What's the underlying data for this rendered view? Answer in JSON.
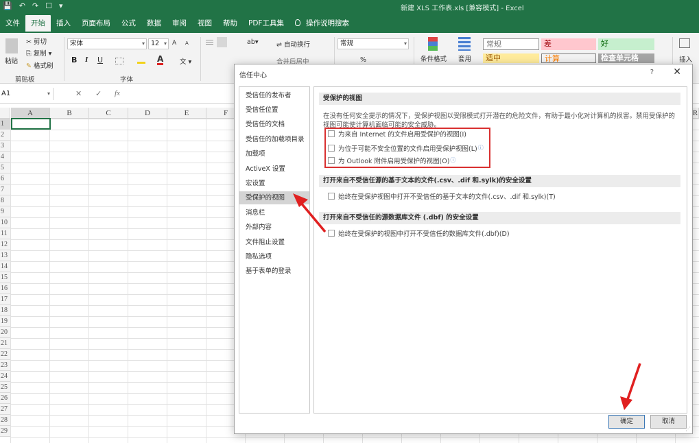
{
  "titlebar": {
    "quick_access": [
      "💾",
      "↶",
      "↷",
      "☐",
      "▾"
    ],
    "title": "新建 XLS 工作表.xls  [兼容模式]  -  Excel"
  },
  "tabs": [
    "文件",
    "开始",
    "插入",
    "页面布局",
    "公式",
    "数据",
    "审阅",
    "视图",
    "帮助",
    "PDF工具集",
    "操作说明搜索"
  ],
  "ribbon": {
    "clipboard": {
      "paste": "粘贴",
      "cut": "剪切",
      "copy": "复制",
      "format_painter": "格式刷",
      "label": "剪贴板"
    },
    "font": {
      "name": "宋体",
      "size": "12",
      "label": "字体",
      "bold": "B",
      "italic": "I",
      "underline": "U",
      "grow": "A",
      "shrink": "A",
      "color": "A"
    },
    "alignment": {
      "wrap": "自动换行",
      "merge": "合并后居中"
    },
    "number": {
      "format": "常规",
      "percent": "%"
    },
    "styles": {
      "conditional": "条件格式",
      "table": "套用",
      "cells": [
        "常规",
        "差",
        "好",
        "适中",
        "计算",
        "检查单元格"
      ]
    },
    "insert": "插入"
  },
  "formula_bar": {
    "name_box": "A1",
    "cancel": "✕",
    "enter": "✓",
    "fx": "fx"
  },
  "grid": {
    "columns": [
      "A",
      "B",
      "C",
      "D",
      "E",
      "F"
    ],
    "rows": [
      "1",
      "2",
      "3",
      "4",
      "5",
      "6",
      "7",
      "8",
      "9",
      "10",
      "11",
      "12",
      "13",
      "14",
      "15",
      "16",
      "17",
      "18",
      "19",
      "20",
      "21",
      "22",
      "23",
      "24",
      "25",
      "26",
      "27",
      "28",
      "29"
    ],
    "right_col": "R"
  },
  "dialog": {
    "title": "信任中心",
    "help": "?",
    "close": "✕",
    "nav": [
      "受信任的发布者",
      "受信任位置",
      "受信任的文档",
      "受信任的加载项目录",
      "加载项",
      "ActiveX 设置",
      "宏设置",
      "受保护的视图",
      "消息栏",
      "外部内容",
      "文件阻止设置",
      "隐私选项",
      "基于表单的登录"
    ],
    "selected_nav": "受保护的视图",
    "section1": {
      "header": "受保护的视图",
      "description": "在没有任何安全提示的情况下，受保护视图以受限模式打开潜在的危险文件，有助于最小化对计算机的损害。禁用受保护的视图可能使计算机面临可能的安全威胁。",
      "options": [
        {
          "label": "为来自 Internet 的文件启用受保护的视图(I)",
          "info": "",
          "checked": false
        },
        {
          "label": "为位于可能不安全位置的文件启用受保护视图(L)",
          "info": "ⓘ",
          "checked": false
        },
        {
          "label": "为 Outlook 附件启用受保护的视图(O)",
          "info": "ⓘ",
          "checked": false
        }
      ]
    },
    "section2": {
      "header": "打开来自不受信任源的基于文本的文件(.csv、.dif 和.sylk)的安全设置",
      "option": "始终在受保护视图中打开不受信任的基于文本的文件(.csv、.dif 和.sylk)(T)"
    },
    "section3": {
      "header": "打开来自不受信任的源数据库文件 (.dbf) 的安全设置",
      "option": "始终在受保护的视图中打开不受信任的数据库文件(.dbf)(D)"
    },
    "ok": "确定",
    "cancel": "取消"
  },
  "colors": {
    "excel_green": "#217346",
    "highlight_red": "#d93030"
  }
}
